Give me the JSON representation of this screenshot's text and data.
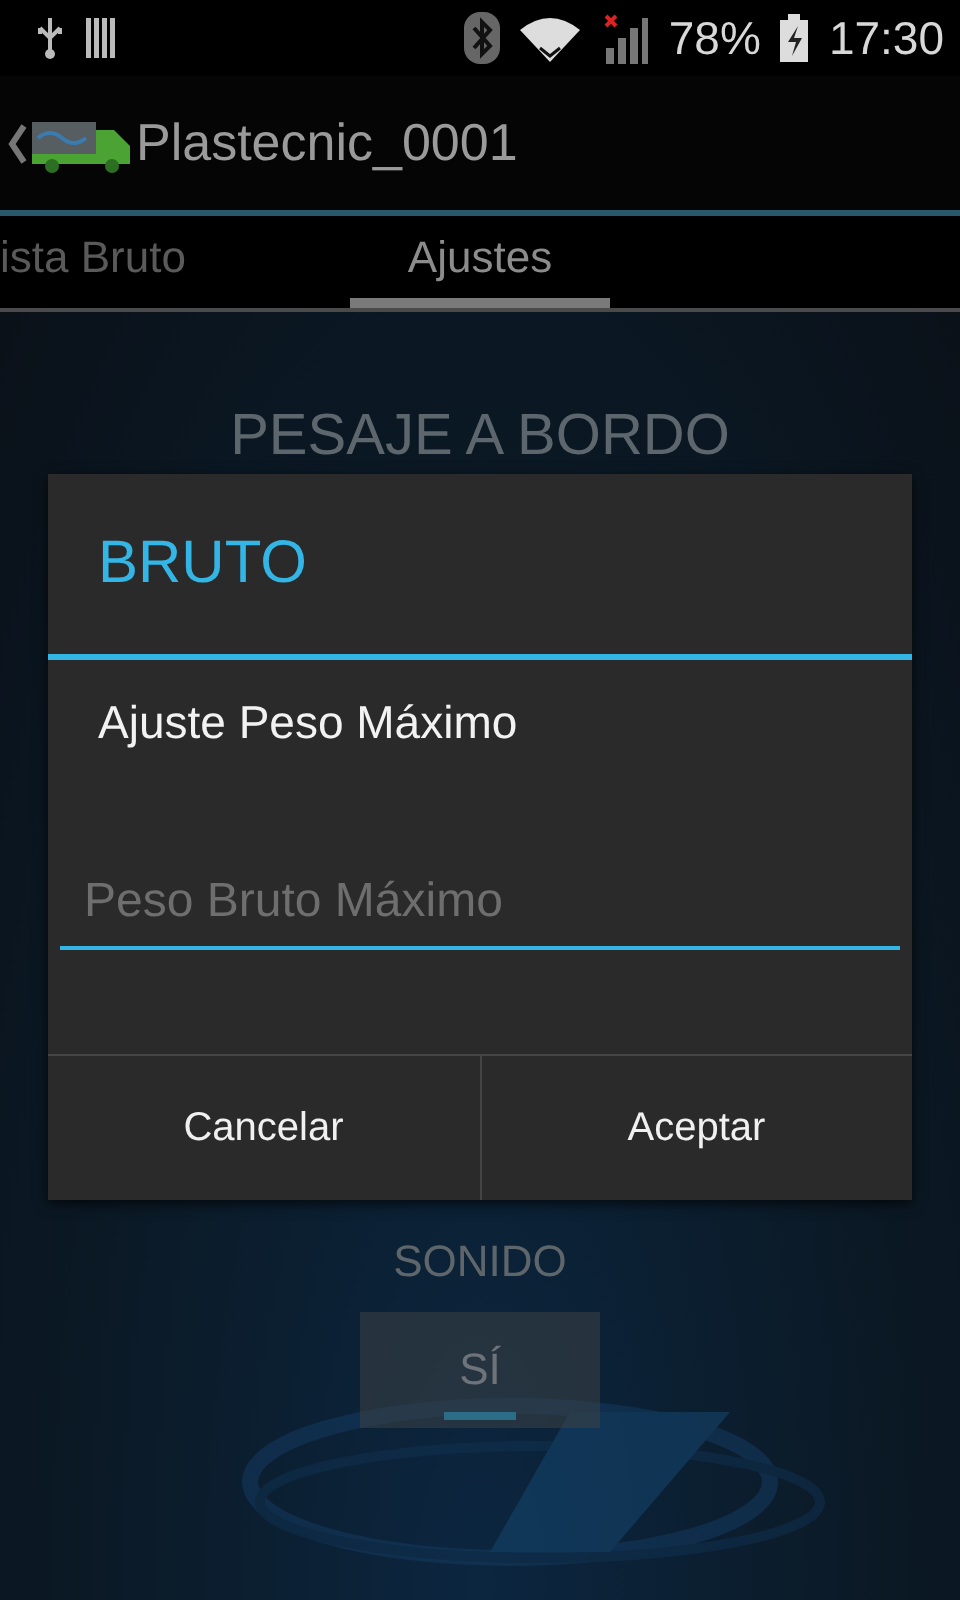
{
  "status_bar": {
    "battery": "78%",
    "time": "17:30"
  },
  "action_bar": {
    "title": "Plastecnic_0001"
  },
  "tabs": [
    {
      "label": "ista Bruto",
      "selected": false
    },
    {
      "label": "Ajustes",
      "selected": true
    }
  ],
  "content": {
    "heading": "PESAJE A BORDO",
    "sound_label": "SONIDO",
    "sound_toggle": {
      "label": "SÍ",
      "on": true
    }
  },
  "dialog": {
    "title": "BRUTO",
    "message": "Ajuste Peso Máximo",
    "input": {
      "placeholder": "Peso Bruto Máximo"
    },
    "buttons": [
      "Cancelar",
      "Aceptar"
    ]
  }
}
